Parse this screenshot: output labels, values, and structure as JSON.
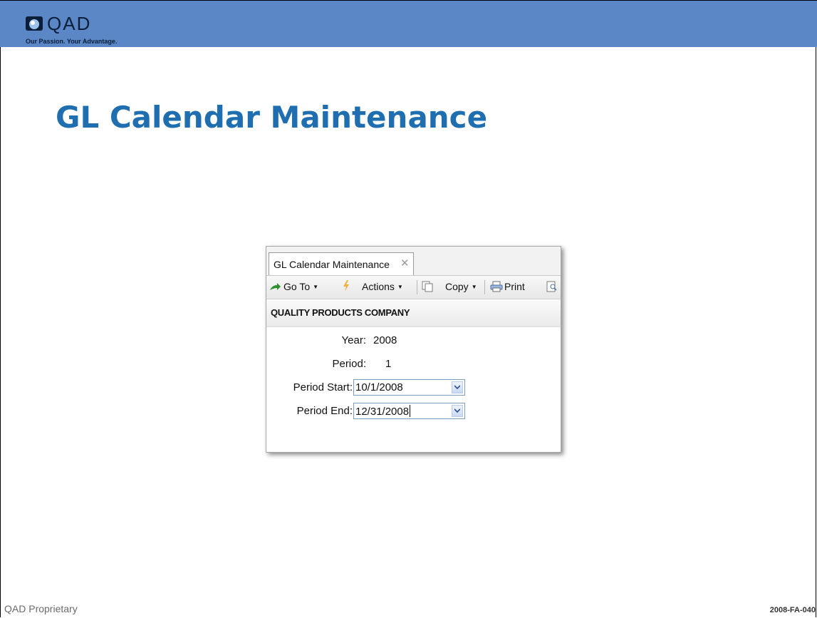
{
  "brand": {
    "name": "QAD",
    "tagline": "Our Passion. Your Advantage."
  },
  "slide": {
    "title": "GL Calendar Maintenance"
  },
  "footer": {
    "left": "QAD Proprietary",
    "right": "2008-FA-040"
  },
  "window": {
    "tab_label": "GL Calendar Maintenance",
    "tab_close": "✕",
    "toolbar": {
      "goto": "Go To",
      "actions": "Actions",
      "copy": "Copy",
      "print": "Print"
    },
    "company": "QUALITY PRODUCTS COMPANY",
    "fields": {
      "year_label": "Year:",
      "year_value": "2008",
      "period_label": "Period:",
      "period_value": "1",
      "period_start_label": "Period Start:",
      "period_start_value": "10/1/2008",
      "period_end_label": "Period End:",
      "period_end_value": "12/31/2008"
    }
  },
  "colors": {
    "topbar": "#5b87c6",
    "title": "#1f6fb0"
  }
}
